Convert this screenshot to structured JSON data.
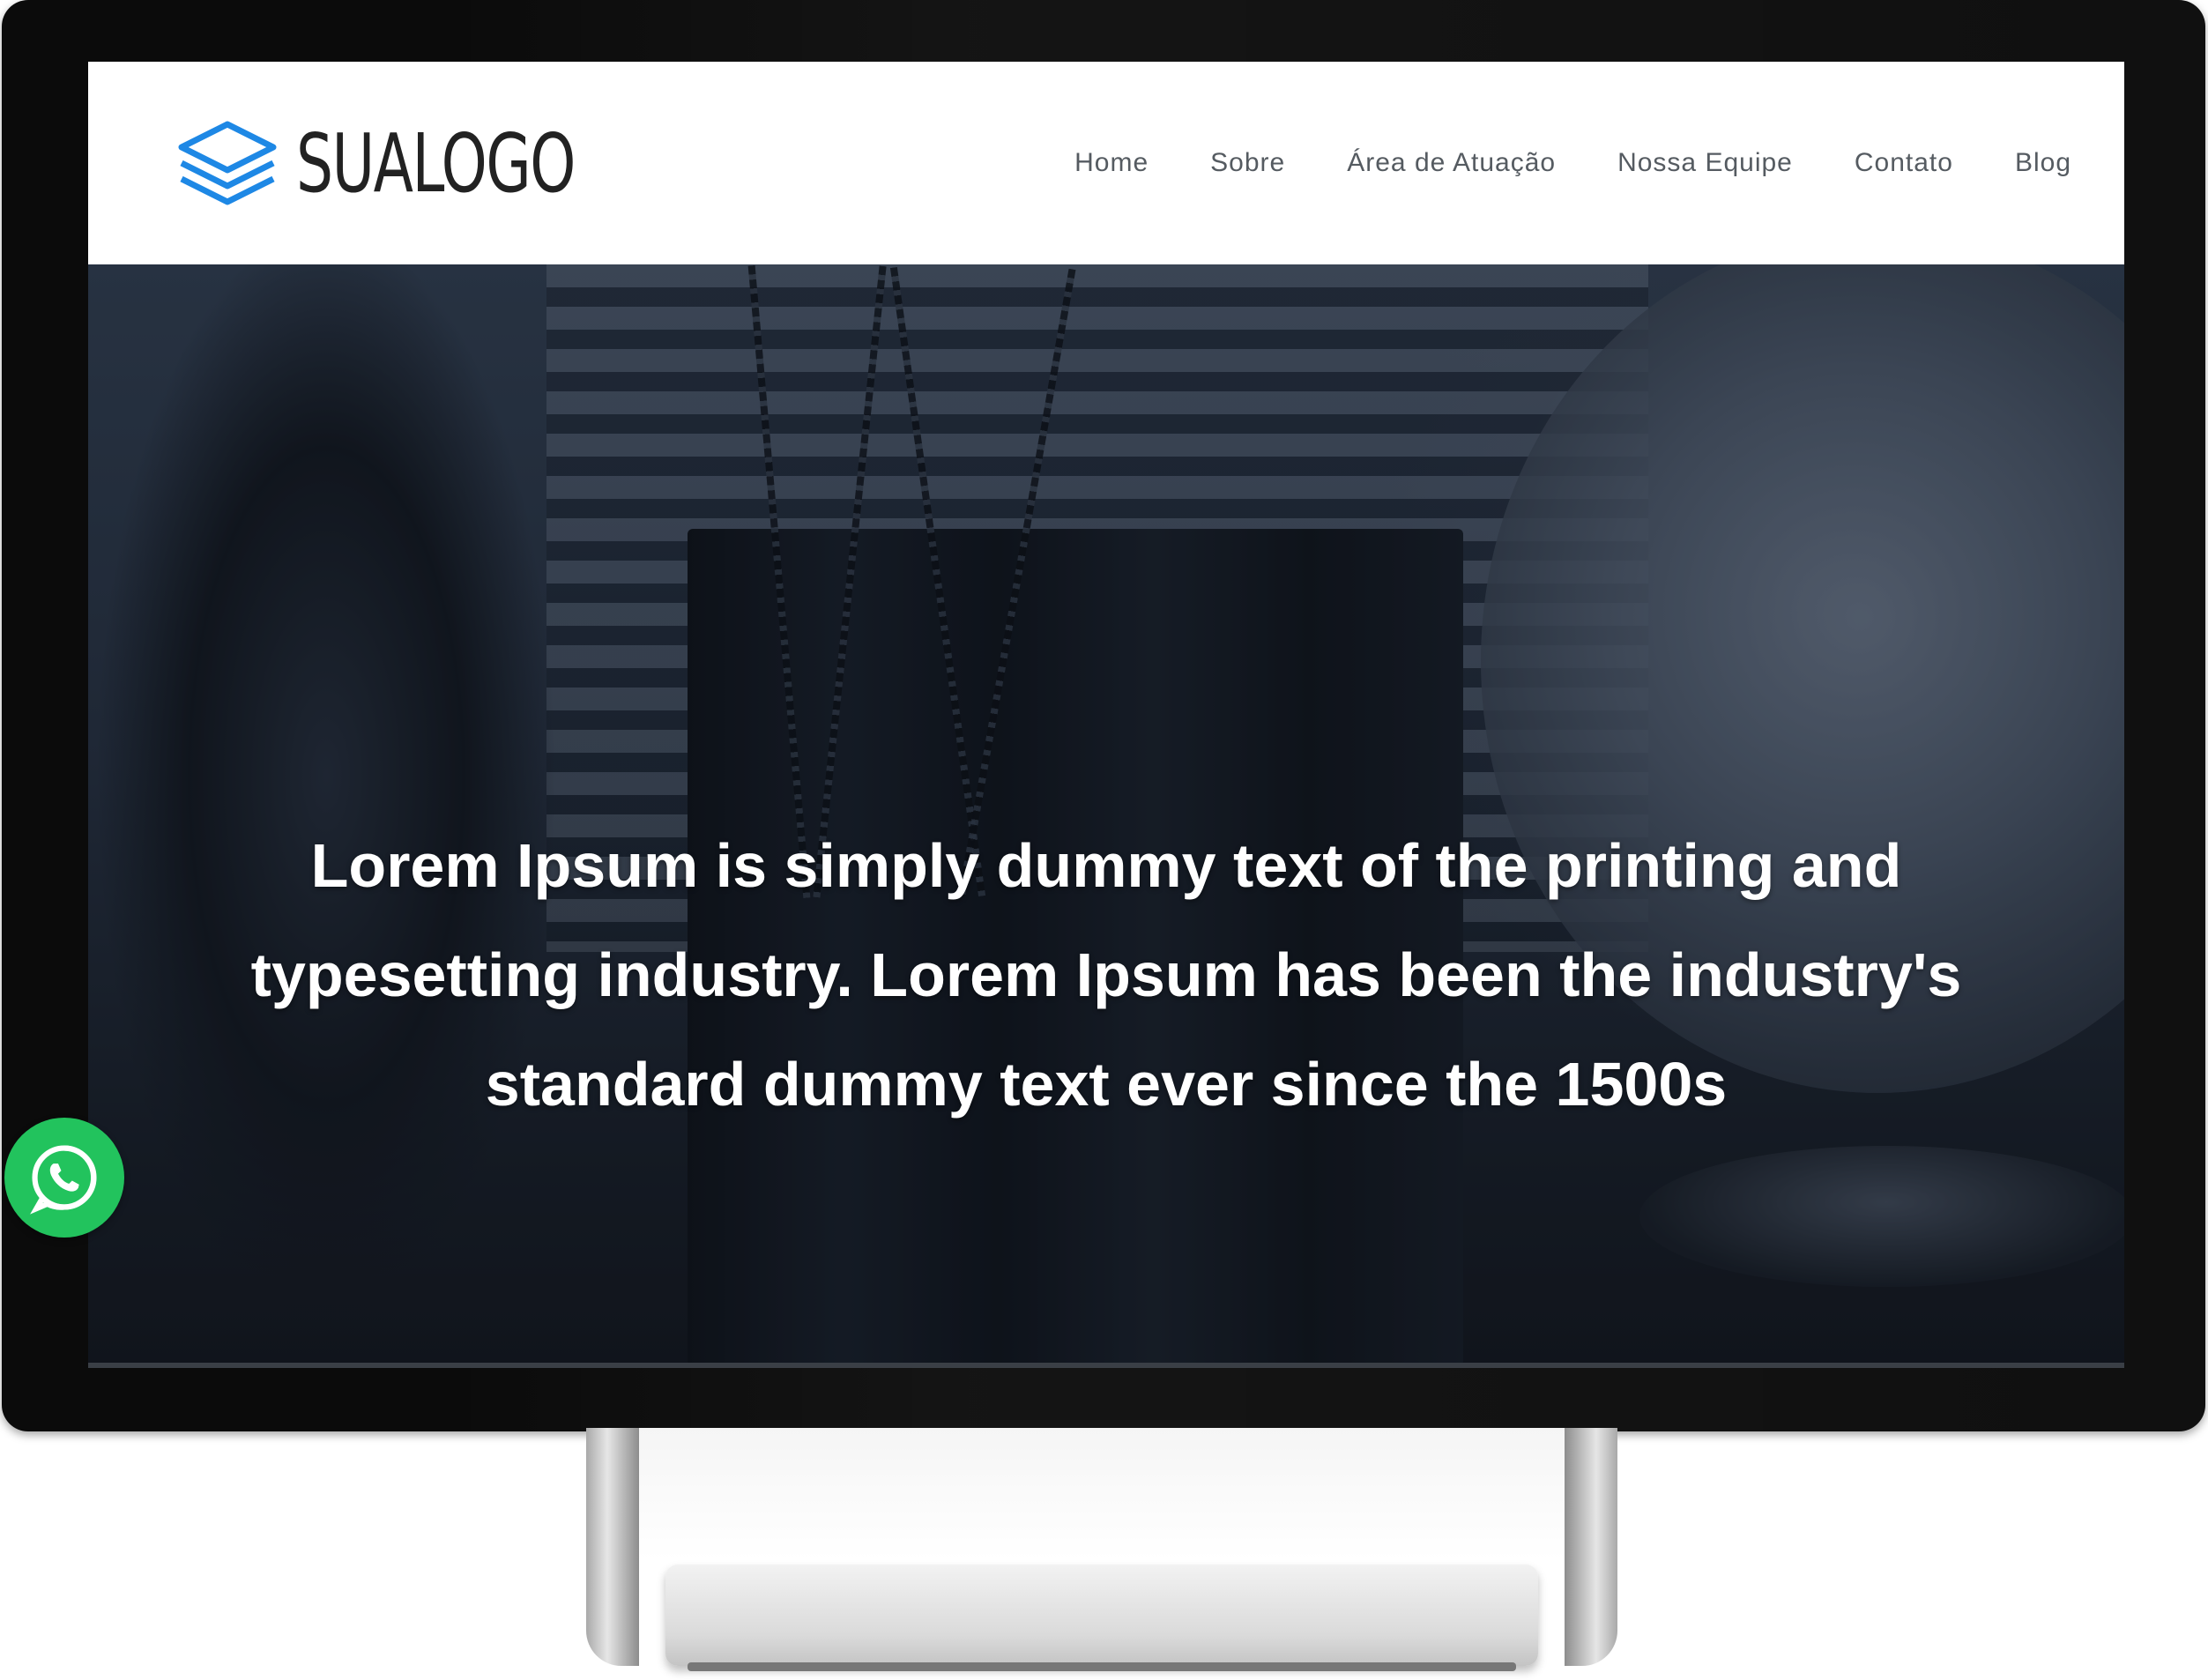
{
  "header": {
    "logo_text": "SUALOGO",
    "logo_icon": "layers-stack-icon",
    "logo_color": "#1e88e5"
  },
  "nav": {
    "items": [
      {
        "label": "Home"
      },
      {
        "label": "Sobre"
      },
      {
        "label": "Área de Atuação"
      },
      {
        "label": "Nossa Equipe"
      },
      {
        "label": "Contato"
      },
      {
        "label": "Blog"
      }
    ]
  },
  "hero": {
    "headline_line1": "Lorem Ipsum is simply dummy text of the printing and",
    "headline_line2": "typesetting industry. Lorem Ipsum has been the industry's",
    "headline_line3": "standard dummy text ever since the 1500s"
  },
  "whatsapp": {
    "icon": "whatsapp-icon",
    "color": "#22c35d"
  }
}
